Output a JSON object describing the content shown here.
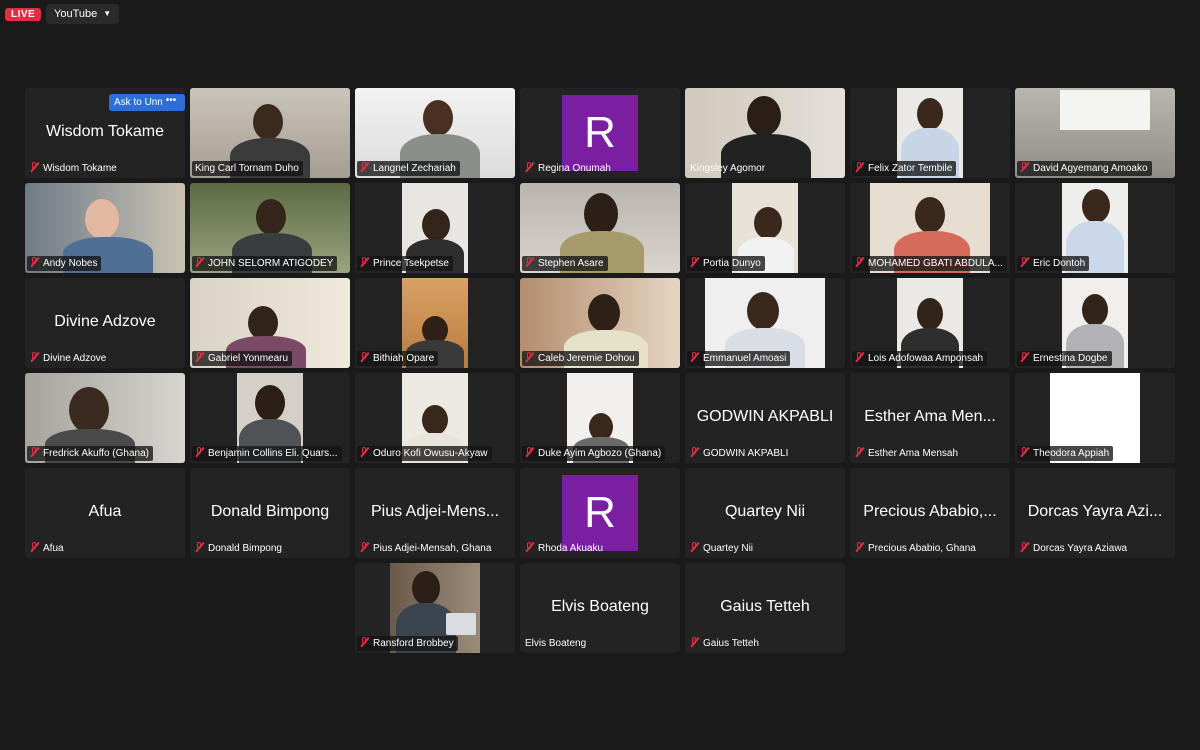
{
  "top_bar": {
    "live_label": "LIVE",
    "stream_target": "YouTube"
  },
  "spotlight": {
    "unmute_label": "Ask to Unmute",
    "more_label": "•••"
  },
  "colors": {
    "live": "#e02f44",
    "active_speaker": "#5bd16c",
    "button_blue": "#2d6fd6",
    "avatar_purple": "#7b1fa2"
  },
  "participants": [
    {
      "name": "Wisdom Tokame",
      "big_name": "Wisdom Tokame"
    },
    {
      "name": "King Carl Tornam Duho"
    },
    {
      "name": "Langnel Zechariah"
    },
    {
      "name": "Regina Onumah",
      "avatar_letter": "R"
    },
    {
      "name": "Kingsley Agomor"
    },
    {
      "name": "Felix Zator Tembile"
    },
    {
      "name": "David Agyemang Amoako"
    },
    {
      "name": "Andy Nobes"
    },
    {
      "name": "JOHN SELORM ATIGODEY"
    },
    {
      "name": "Prince Tsekpetse"
    },
    {
      "name": "Stephen Asare"
    },
    {
      "name": "Portia Dunyo"
    },
    {
      "name": "MOHAMED GBATI ABDULA..."
    },
    {
      "name": "Eric Dontoh"
    },
    {
      "name": "Divine Adzove",
      "big_name": "Divine Adzove"
    },
    {
      "name": "Gabriel Yonmearu"
    },
    {
      "name": "Bithiah Opare"
    },
    {
      "name": "Caleb Jeremie Dohou"
    },
    {
      "name": "Emmanuel Amoasi"
    },
    {
      "name": "Lois Adofowaa Amponsah"
    },
    {
      "name": "Ernestina Dogbe"
    },
    {
      "name": "Fredrick Akuffo (Ghana)"
    },
    {
      "name": "Benjamin Collins Eli. Quars..."
    },
    {
      "name": "Oduro Kofi Owusu-Akyaw"
    },
    {
      "name": "Duke Ayim Agbozo (Ghana)"
    },
    {
      "name": "GODWIN AKPABLI",
      "big_name": "GODWIN AKPABLI"
    },
    {
      "name": "Esther Ama Mensah",
      "big_name": "Esther Ama Men..."
    },
    {
      "name": "Theodora Appiah"
    },
    {
      "name": "Afua",
      "big_name": "Afua"
    },
    {
      "name": "Donald Bimpong",
      "big_name": "Donald Bimpong"
    },
    {
      "name": "Pius Adjei-Mensah, Ghana",
      "big_name": "Pius Adjei-Mens..."
    },
    {
      "name": "Rhoda Akuaku",
      "avatar_letter": "R"
    },
    {
      "name": "Quartey Nii",
      "big_name": "Quartey Nii"
    },
    {
      "name": "Precious Ababio, Ghana",
      "big_name": "Precious Ababio,..."
    },
    {
      "name": "Dorcas Yayra Aziawa",
      "big_name": "Dorcas Yayra Azi..."
    },
    {
      "name": "Ransford Brobbey"
    },
    {
      "name": "Elvis Boateng",
      "big_name": "Elvis Boateng"
    },
    {
      "name": "Gaius Tetteh",
      "big_name": "Gaius Tetteh"
    }
  ]
}
